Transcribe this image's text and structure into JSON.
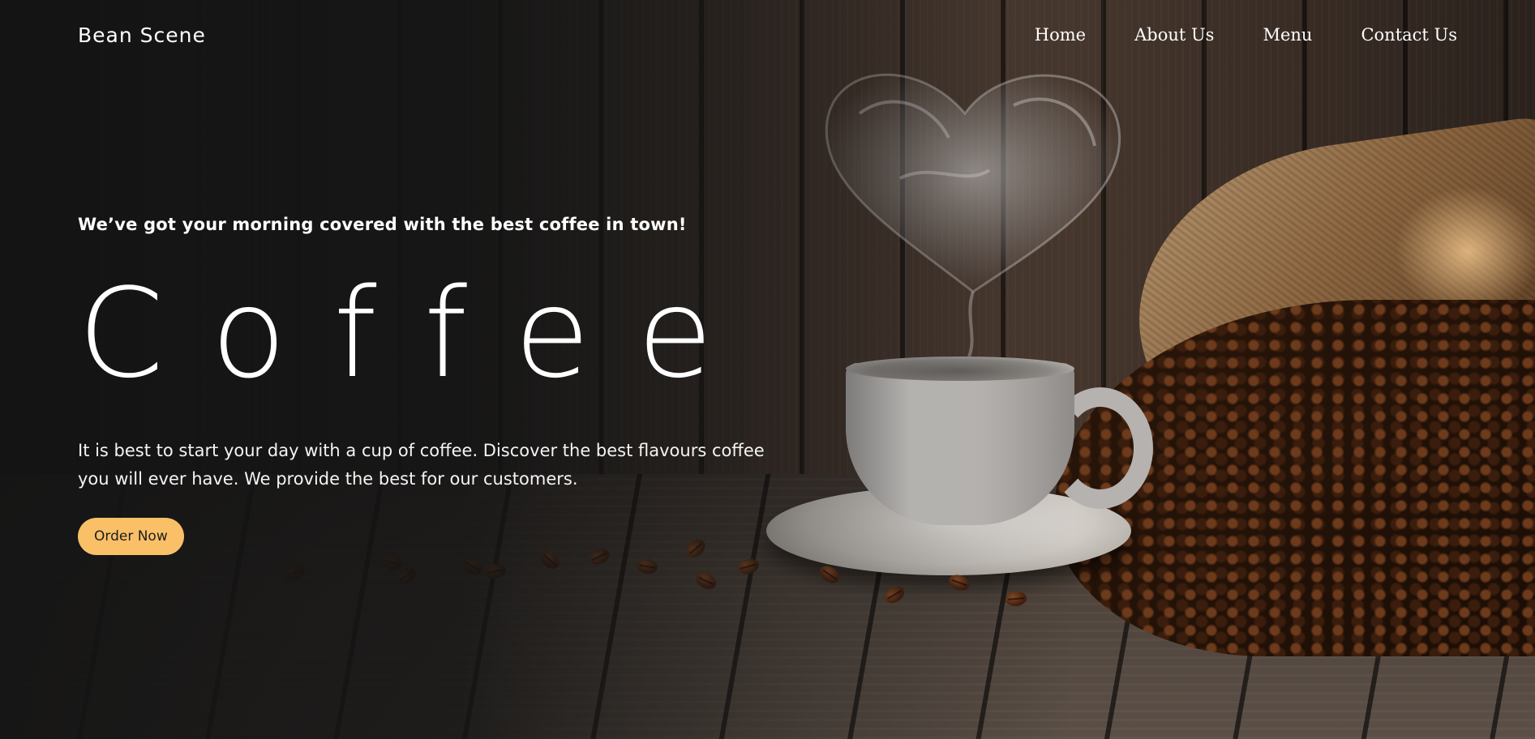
{
  "brand": {
    "name": "Bean Scene"
  },
  "nav": {
    "items": [
      {
        "label": "Home"
      },
      {
        "label": "About Us"
      },
      {
        "label": "Menu"
      },
      {
        "label": "Contact Us"
      }
    ]
  },
  "hero": {
    "tagline": "We’ve got your morning covered with the best coffee in town!",
    "headline": "Coffee",
    "description": "It is best to start your day with a cup of coffee. Discover the best flavours coffee you will ever have. We provide the best for our customers.",
    "cta_label": "Order Now"
  },
  "colors": {
    "accent": "#f9c068",
    "background": "#1b1b1b",
    "text": "#ffffff"
  },
  "background_image": {
    "elements": [
      "heart-shaped-steam",
      "coffee-cup-and-saucer",
      "burlap-sack",
      "coffee-beans",
      "wooden-table",
      "wooden-wall"
    ]
  }
}
